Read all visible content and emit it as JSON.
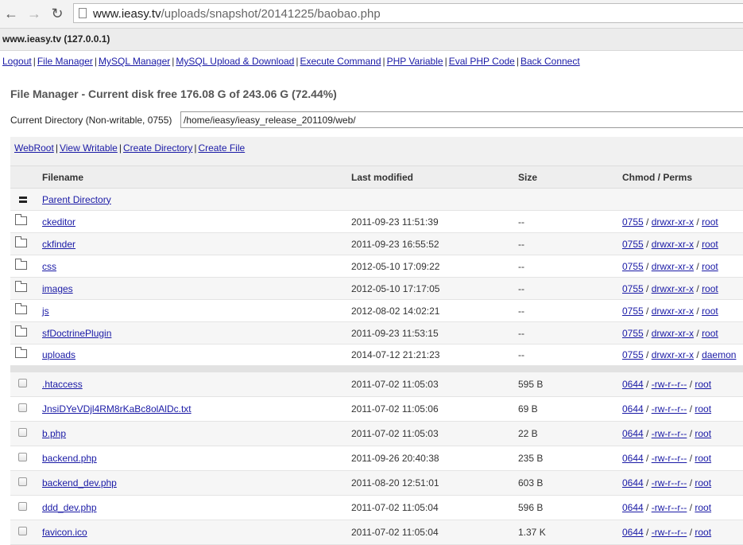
{
  "browser": {
    "url_host": "www.ieasy.tv",
    "url_path": "/uploads/snapshot/20141225/baobao.php"
  },
  "header": {
    "host": "www.ieasy.tv (127.0.0.1)"
  },
  "menu": [
    "Logout",
    "File Manager",
    "MySQL Manager",
    "MySQL Upload & Download",
    "Execute Command",
    "PHP Variable",
    "Eval PHP Code",
    "Back Connect"
  ],
  "title": "File Manager - Current disk free 176.08 G of 243.06 G (72.44%)",
  "current_dir": {
    "label": "Current Directory (Non-writable, 0755)",
    "value": "/home/ieasy/ieasy_release_201109/web/"
  },
  "tools": [
    "WebRoot",
    "View Writable",
    "Create Directory",
    "Create File"
  ],
  "columns": {
    "filename": "Filename",
    "modified": "Last modified",
    "size": "Size",
    "perms": "Chmod / Perms"
  },
  "parent": "Parent Directory",
  "dirs": [
    {
      "name": "ckeditor",
      "modified": "2011-09-23 11:51:39",
      "size": "--",
      "chmod": "0755",
      "perm": "drwxr-xr-x",
      "owner": "root"
    },
    {
      "name": "ckfinder",
      "modified": "2011-09-23 16:55:52",
      "size": "--",
      "chmod": "0755",
      "perm": "drwxr-xr-x",
      "owner": "root"
    },
    {
      "name": "css",
      "modified": "2012-05-10 17:09:22",
      "size": "--",
      "chmod": "0755",
      "perm": "drwxr-xr-x",
      "owner": "root"
    },
    {
      "name": "images",
      "modified": "2012-05-10 17:17:05",
      "size": "--",
      "chmod": "0755",
      "perm": "drwxr-xr-x",
      "owner": "root"
    },
    {
      "name": "js",
      "modified": "2012-08-02 14:02:21",
      "size": "--",
      "chmod": "0755",
      "perm": "drwxr-xr-x",
      "owner": "root"
    },
    {
      "name": "sfDoctrinePlugin",
      "modified": "2011-09-23 11:53:15",
      "size": "--",
      "chmod": "0755",
      "perm": "drwxr-xr-x",
      "owner": "root"
    },
    {
      "name": "uploads",
      "modified": "2014-07-12 21:21:23",
      "size": "--",
      "chmod": "0755",
      "perm": "drwxr-xr-x",
      "owner": "daemon"
    }
  ],
  "files": [
    {
      "name": ".htaccess",
      "modified": "2011-07-02 11:05:03",
      "size": "595 B",
      "chmod": "0644",
      "perm": "-rw-r--r--",
      "owner": "root"
    },
    {
      "name": "JnsiDYeVDjl4RM8rKaBc8olAlDc.txt",
      "modified": "2011-07-02 11:05:06",
      "size": "69 B",
      "chmod": "0644",
      "perm": "-rw-r--r--",
      "owner": "root"
    },
    {
      "name": "b.php",
      "modified": "2011-07-02 11:05:03",
      "size": "22 B",
      "chmod": "0644",
      "perm": "-rw-r--r--",
      "owner": "root"
    },
    {
      "name": "backend.php",
      "modified": "2011-09-26 20:40:38",
      "size": "235 B",
      "chmod": "0644",
      "perm": "-rw-r--r--",
      "owner": "root"
    },
    {
      "name": "backend_dev.php",
      "modified": "2011-08-20 12:51:01",
      "size": "603 B",
      "chmod": "0644",
      "perm": "-rw-r--r--",
      "owner": "root"
    },
    {
      "name": "ddd_dev.php",
      "modified": "2011-07-02 11:05:04",
      "size": "596 B",
      "chmod": "0644",
      "perm": "-rw-r--r--",
      "owner": "root"
    },
    {
      "name": "favicon.ico",
      "modified": "2011-07-02 11:05:04",
      "size": "1.37 K",
      "chmod": "0644",
      "perm": "-rw-r--r--",
      "owner": "root"
    }
  ]
}
